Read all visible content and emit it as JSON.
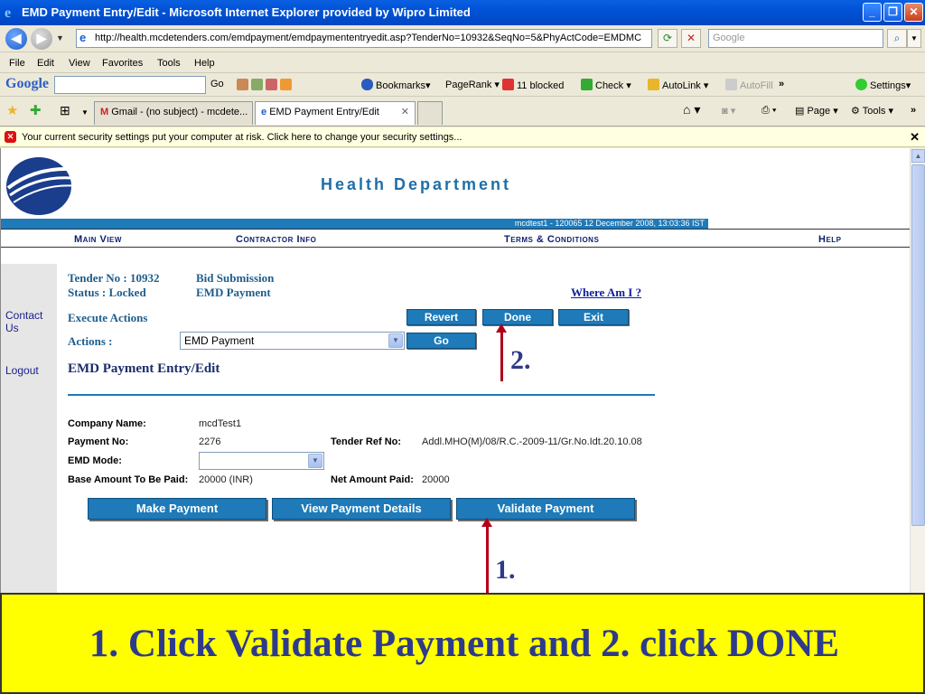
{
  "window": {
    "title": "EMD Payment Entry/Edit - Microsoft Internet Explorer provided by Wipro Limited"
  },
  "addressbar": {
    "url": "http://health.mcdetenders.com/emdpayment/emdpaymententryedit.asp?TenderNo=10932&SeqNo=5&PhyActCode=EMDMC",
    "search_placeholder": "Google"
  },
  "menubar": [
    "File",
    "Edit",
    "View",
    "Favorites",
    "Tools",
    "Help"
  ],
  "google_toolbar": {
    "logo": "Google",
    "go": "Go",
    "bookmarks": "Bookmarks",
    "pagerank": "PageRank",
    "blocked": "11 blocked",
    "check": "Check",
    "autolink": "AutoLink",
    "autofill": "AutoFill",
    "more": "»",
    "settings": "Settings"
  },
  "tabs": {
    "gmail": "Gmail - (no subject) - mcdete...",
    "active": "EMD Payment Entry/Edit",
    "page": "Page",
    "tools": "Tools"
  },
  "infobar": {
    "message": "Your current security settings put your computer at risk. Click here to change your security settings..."
  },
  "page": {
    "department": "Health Department",
    "userbar": "mcdtest1 - 120065      12 December 2008,  13:03:36  IST",
    "nav": [
      "Main View",
      "Contractor Info",
      "Terms & Conditions",
      "Help"
    ],
    "left_links": [
      "Contact Us",
      "Logout"
    ],
    "tender_no": "Tender No : 10932",
    "status": "Status : Locked",
    "bid_submission": "Bid Submission",
    "emd_payment_label": "EMD Payment",
    "where_am_i": "Where Am I ?",
    "execute_actions": "Execute Actions",
    "revert": "Revert",
    "done": "Done",
    "exit": "Exit",
    "actions_label": "Actions :",
    "actions_value": "EMD Payment",
    "go": "Go",
    "form_title": "EMD Payment Entry/Edit",
    "company_name_label": "Company Name:",
    "company_name": "mcdTest1",
    "payment_no_label": "Payment No:",
    "payment_no": "2276",
    "tender_ref_label": "Tender Ref No:",
    "tender_ref": "Addl.MHO(M)/08/R.C.-2009-11/Gr.No.Idt.20.10.08",
    "emd_mode_label": "EMD Mode:",
    "emd_mode_value": "",
    "base_amount_label": "Base Amount To Be Paid:",
    "base_amount": "20000 (INR)",
    "net_amount_label": "Net Amount Paid:",
    "net_amount": "20000",
    "make_payment": "Make Payment",
    "view_payment_details": "View Payment Details",
    "validate_payment": "Validate Payment"
  },
  "annotations": {
    "step1": "1.",
    "step2": "2.",
    "caption": "1. Click Validate Payment and 2. click DONE"
  },
  "colors": {
    "accent": "#1e7ab8",
    "arrow": "#b00018",
    "caption_bg": "#ffff00",
    "caption_text": "#2e3a8c"
  }
}
